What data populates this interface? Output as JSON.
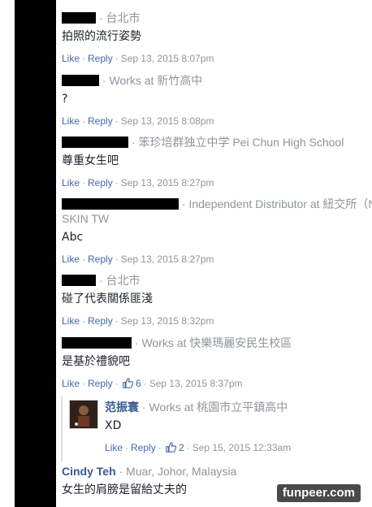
{
  "comments": [
    {
      "suffix": "· 台北市",
      "text": "拍照的流行姿勢",
      "like": "Like",
      "reply": "Reply",
      "date": "Sep 13, 2015 8:07pm"
    },
    {
      "suffix": "· Works at 新竹高中",
      "text": "?",
      "like": "Like",
      "reply": "Reply",
      "date": "Sep 13, 2015 8:08pm"
    },
    {
      "suffix": "· 笨珍培群独立中学 Pei Chun High School",
      "text": "尊重女生吧",
      "like": "Like",
      "reply": "Reply",
      "date": "Sep 13, 2015 8:27pm"
    },
    {
      "suffix": "· Independent Distributor at 紐交所（N",
      "suffix2": "SKIN TW",
      "text": "Abc",
      "like": "Like",
      "reply": "Reply",
      "date": "Sep 13, 2015 8:27pm"
    },
    {
      "suffix": "· 台北市",
      "text": "碰了代表關係匪淺",
      "like": "Like",
      "reply": "Reply",
      "date": "Sep 13, 2015 8:32pm"
    },
    {
      "suffix": "· Works at 快樂瑪麗安民生校區",
      "text": "是基於禮貌吧",
      "like": "Like",
      "reply": "Reply",
      "likes": "6",
      "date": "Sep 13, 2015 8:37pm"
    }
  ],
  "reply": {
    "name": "范振寰",
    "suffix": "· Works at 桃園市立平鎮高中",
    "text": "XD",
    "like": "Like",
    "reply": "Reply",
    "likes": "2",
    "date": "Sep 15, 2015 12:33am"
  },
  "last": {
    "name": "Cindy Teh",
    "suffix": "· Muar, Johor, Malaysia",
    "text": "女生的肩膀是留給丈夫的"
  },
  "watermark": "funpeer.com",
  "colors": {
    "link": "#4267b2",
    "name": "#365899",
    "meta": "#90949c"
  }
}
